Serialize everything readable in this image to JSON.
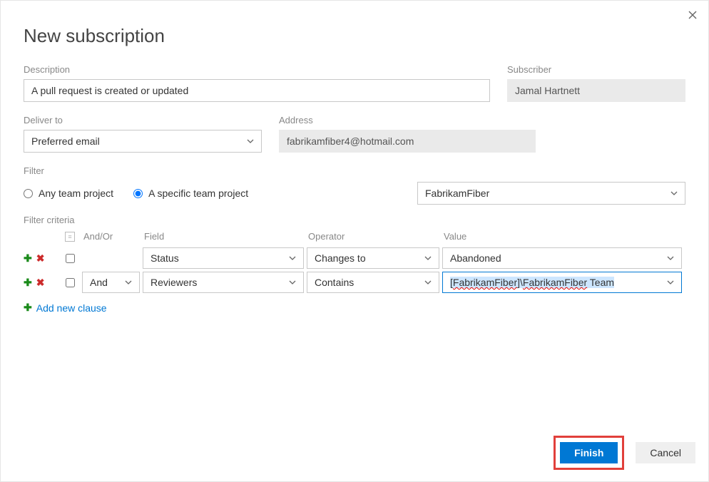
{
  "title": "New subscription",
  "labels": {
    "description": "Description",
    "subscriber": "Subscriber",
    "deliverTo": "Deliver to",
    "address": "Address",
    "filter": "Filter",
    "filterCriteria": "Filter criteria"
  },
  "description": "A pull request is created or updated",
  "subscriber": "Jamal Hartnett",
  "deliverTo": "Preferred email",
  "address": "fabrikamfiber4@hotmail.com",
  "filterOptions": {
    "anyTeamProject": "Any team project",
    "specificTeamProject": "A specific team project",
    "selected": "specific",
    "project": "FabrikamFiber"
  },
  "criteriaHeaders": {
    "andOr": "And/Or",
    "field": "Field",
    "operator": "Operator",
    "value": "Value"
  },
  "criteriaRows": [
    {
      "andOr": "",
      "field": "Status",
      "operator": "Changes to",
      "value": "Abandoned",
      "valueActive": false
    },
    {
      "andOr": "And",
      "field": "Reviewers",
      "operator": "Contains",
      "value": "[FabrikamFiber]\\FabrikamFiber Team",
      "valueActive": true
    }
  ],
  "addClauseLabel": "Add new clause",
  "buttons": {
    "finish": "Finish",
    "cancel": "Cancel"
  }
}
